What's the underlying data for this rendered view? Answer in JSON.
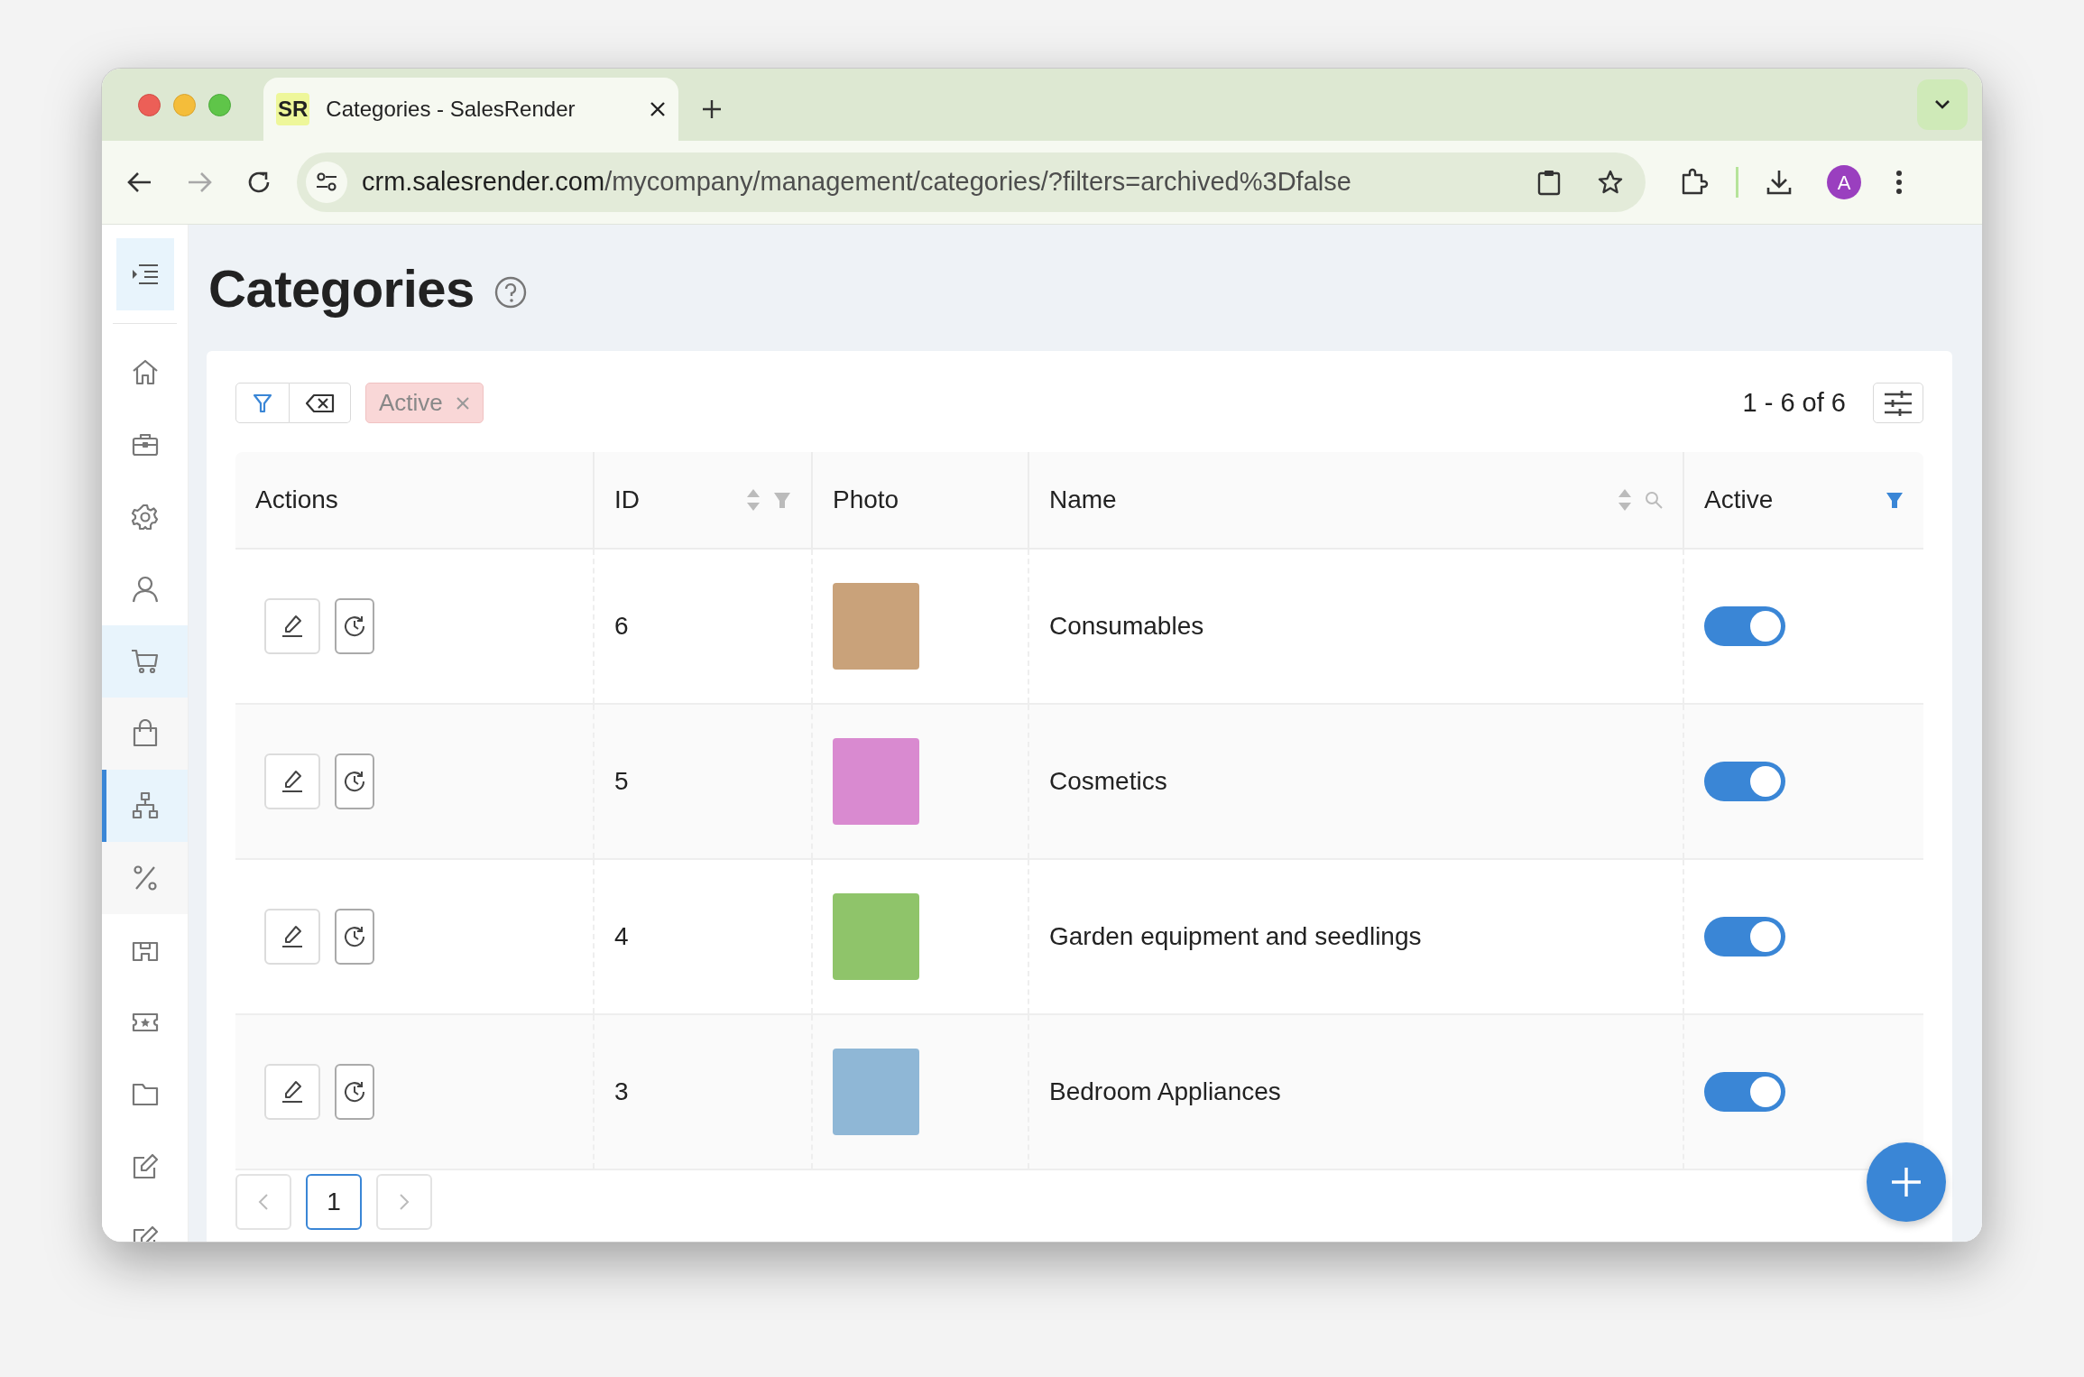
{
  "browser": {
    "tab": {
      "favicon_text": "SR",
      "title": "Categories - SalesRender"
    },
    "address": {
      "domain": "crm.salesrender.com",
      "path": "/mycompany/management/categories/?filters=archived%3Dfalse"
    },
    "forward_disabled": true,
    "profile_initial": "A"
  },
  "sidebar": {
    "items": [
      {
        "kind": "home",
        "selected": false
      },
      {
        "kind": "briefcase",
        "selected": false
      },
      {
        "kind": "gear",
        "selected": false
      },
      {
        "kind": "user",
        "selected": false
      },
      {
        "kind": "cart",
        "selected": false,
        "expanded": true,
        "children": [
          {
            "kind": "bag",
            "selected": false
          },
          {
            "kind": "sitemap",
            "selected": true
          },
          {
            "kind": "percent",
            "selected": false
          }
        ]
      },
      {
        "kind": "store",
        "selected": false
      },
      {
        "kind": "ticket",
        "selected": false
      },
      {
        "kind": "folder",
        "selected": false
      },
      {
        "kind": "edit",
        "selected": false
      },
      {
        "kind": "edit",
        "selected": false
      }
    ]
  },
  "page": {
    "title": "Categories"
  },
  "filters": {
    "chips": [
      {
        "label": "Active"
      }
    ],
    "range": "1 - 6 of 6"
  },
  "table": {
    "columns": [
      {
        "label": "Actions",
        "kind": "plain"
      },
      {
        "label": "ID",
        "kind": "filterable"
      },
      {
        "label": "Photo",
        "kind": "plain"
      },
      {
        "label": "Name",
        "kind": "searchable"
      },
      {
        "label": "Active",
        "kind": "filtered"
      }
    ],
    "rows": [
      {
        "id": "6",
        "name": "Consumables",
        "active": true
      },
      {
        "id": "5",
        "name": "Cosmetics",
        "active": true
      },
      {
        "id": "4",
        "name": "Garden equipment and seedlings",
        "active": true
      },
      {
        "id": "3",
        "name": "Bedroom Appliances",
        "active": true
      }
    ]
  },
  "pagination": {
    "pages": [
      {
        "label": "1",
        "selected": true
      }
    ]
  }
}
